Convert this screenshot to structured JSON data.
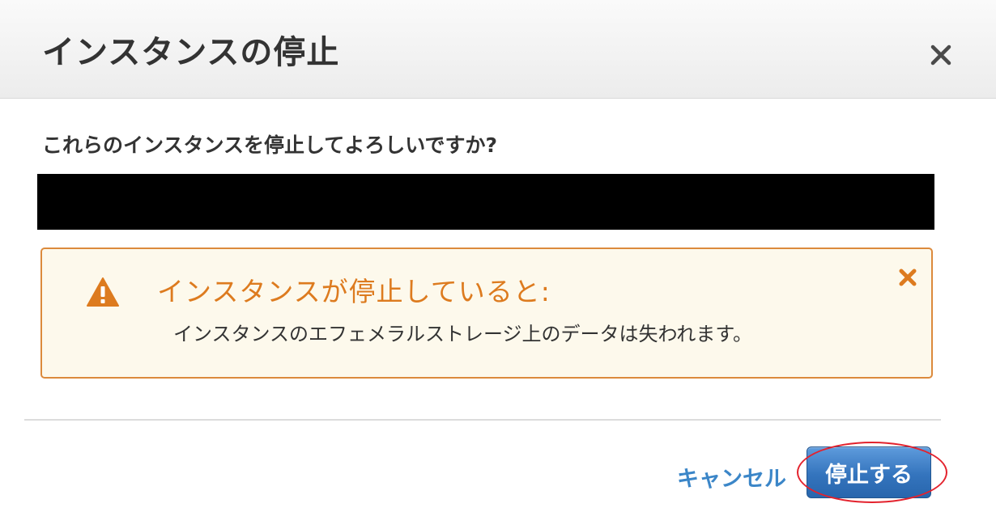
{
  "dialog": {
    "title": "インスタンスの停止",
    "close_icon": "close-icon",
    "question": "これらのインスタンスを停止してよろしいですか?",
    "alert": {
      "icon": "warning-icon",
      "dismiss_icon": "dismiss-icon",
      "title": "インスタンスが停止していると:",
      "message": "インスタンスのエフェメラルストレージ上のデータは失われます。",
      "colors": {
        "background": "#fdf9ec",
        "border": "#dc8a3c",
        "accent": "#dd7b1f"
      }
    },
    "footer": {
      "cancel_label": "キャンセル",
      "stop_label": "停止する"
    },
    "colors": {
      "link": "#3b86c8",
      "primary": "#3474bd",
      "highlight_ring": "#e3222d"
    }
  }
}
